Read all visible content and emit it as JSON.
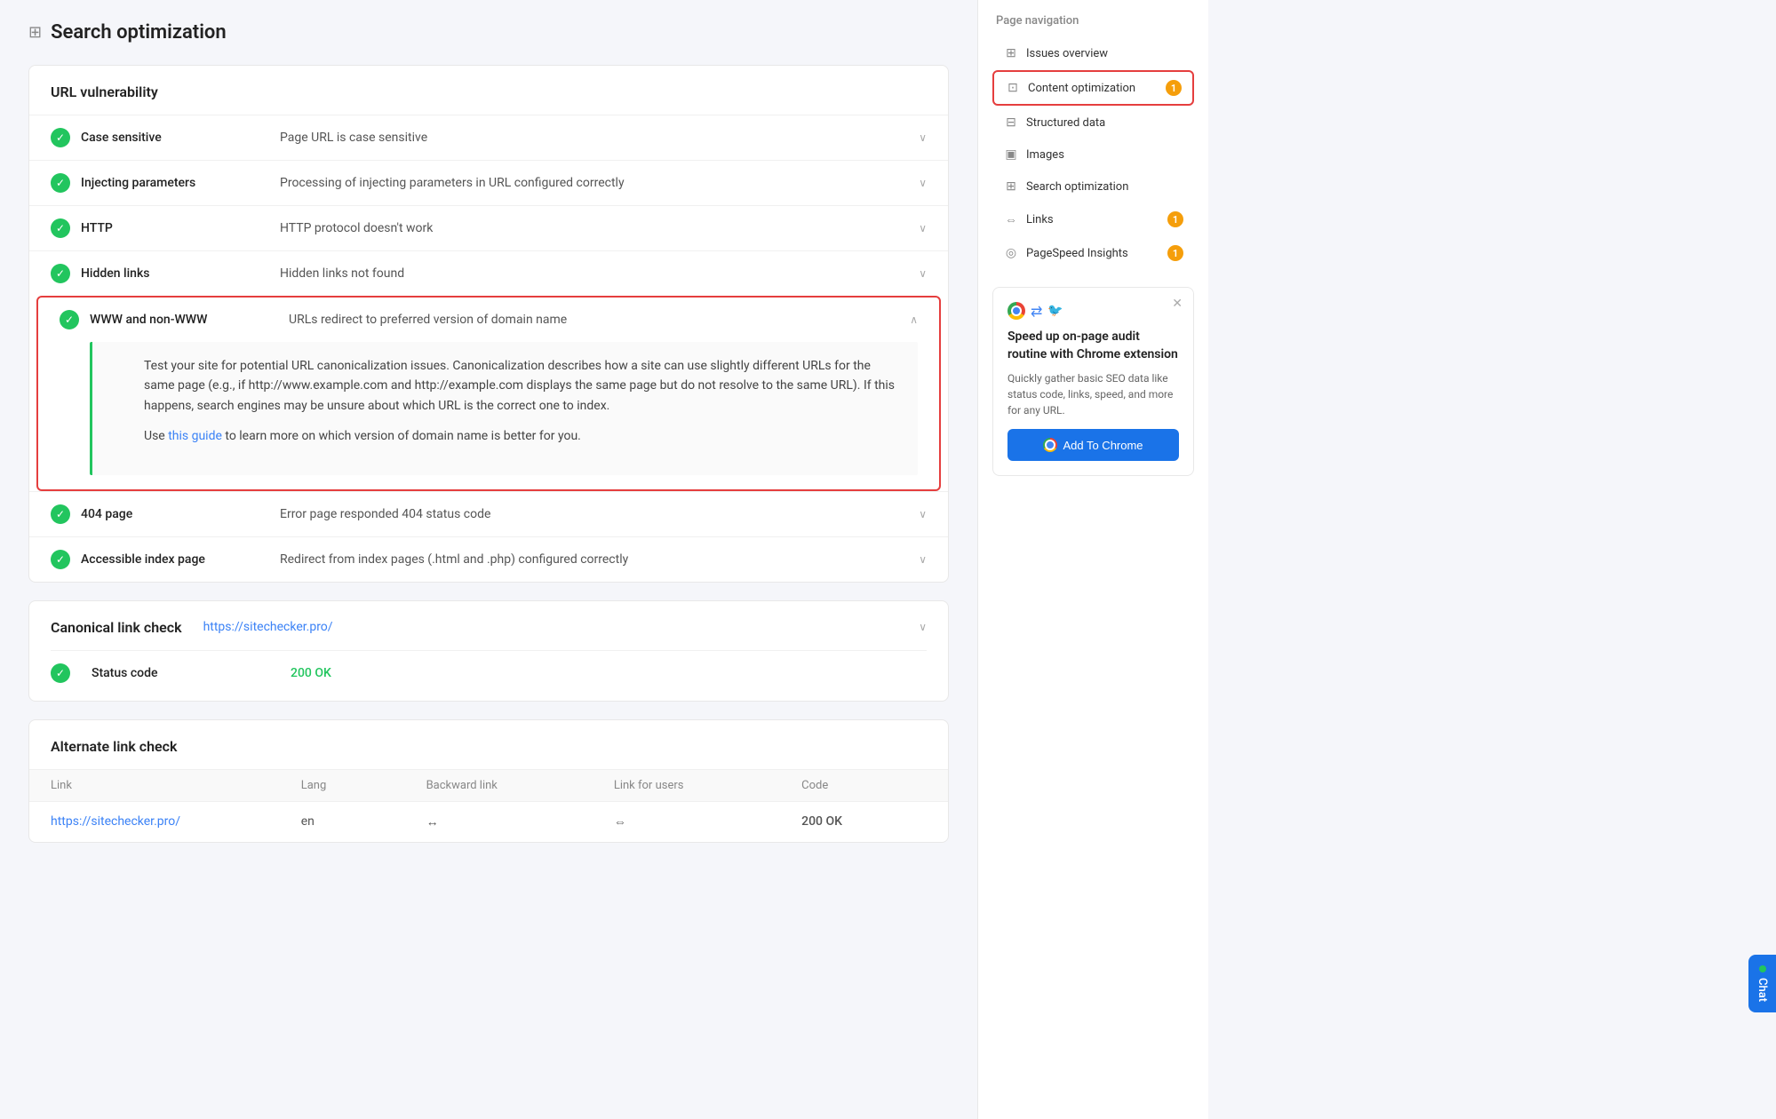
{
  "page": {
    "title": "Search optimization",
    "icon": "⊞"
  },
  "nav": {
    "title": "Page navigation",
    "items": [
      {
        "id": "issues-overview",
        "label": "Issues overview",
        "badge": null,
        "active": false
      },
      {
        "id": "content-optimization",
        "label": "Content optimization",
        "badge": "1",
        "active": true
      },
      {
        "id": "structured-data",
        "label": "Structured data",
        "badge": null,
        "active": false
      },
      {
        "id": "images",
        "label": "Images",
        "badge": null,
        "active": false
      },
      {
        "id": "search-optimization",
        "label": "Search optimization",
        "badge": null,
        "active": false
      },
      {
        "id": "links",
        "label": "Links",
        "badge": "1",
        "active": false
      },
      {
        "id": "pagespeed",
        "label": "PageSpeed Insights",
        "badge": "1",
        "active": false
      }
    ]
  },
  "url_vulnerability": {
    "title": "URL vulnerability",
    "checks": [
      {
        "id": "case-sensitive",
        "label": "Case sensitive",
        "description": "Page URL is case sensitive",
        "expanded": false
      },
      {
        "id": "injecting-params",
        "label": "Injecting parameters",
        "description": "Processing of injecting parameters in URL configured correctly",
        "expanded": false
      },
      {
        "id": "http",
        "label": "HTTP",
        "description": "HTTP protocol doesn't work",
        "expanded": false
      },
      {
        "id": "hidden-links",
        "label": "Hidden links",
        "description": "Hidden links not found",
        "expanded": false
      }
    ],
    "expanded_item": {
      "label": "WWW and non-WWW",
      "description": "URLs redirect to preferred version of domain name",
      "detail_p1": "Test your site for potential URL canonicalization issues. Canonicalization describes how a site can use slightly different URLs for the same page (e.g., if http://www.example.com and http://example.com displays the same page but do not resolve to the same URL). If this happens, search engines may be unsure about which URL is the correct one to index.",
      "detail_p2_prefix": "Use ",
      "detail_link_text": "this guide",
      "detail_p2_suffix": " to learn more on which version of domain name is better for you.",
      "detail_link_href": "#"
    },
    "more_checks": [
      {
        "id": "404-page",
        "label": "404 page",
        "description": "Error page responded 404 status code"
      },
      {
        "id": "accessible-index",
        "label": "Accessible index page",
        "description": "Redirect from index pages (.html and .php) configured correctly"
      }
    ]
  },
  "canonical": {
    "title": "Canonical link check",
    "url": "https://sitechecker.pro/",
    "status_label": "Status code",
    "status_value": "200 OK"
  },
  "alternate": {
    "title": "Alternate link check",
    "columns": [
      "Link",
      "Lang",
      "Backward link",
      "Link for users",
      "Code"
    ],
    "rows": [
      {
        "link": "https://sitechecker.pro/",
        "lang": "en",
        "backward": "↔",
        "for_users": "⇔",
        "code": "200 OK"
      }
    ]
  },
  "promo": {
    "title": "Speed up on-page audit routine with Chrome extension",
    "description": "Quickly gather basic SEO data like status code, links, speed, and more for any URL.",
    "button_label": "Add To Chrome"
  },
  "chat": {
    "label": "Chat"
  }
}
